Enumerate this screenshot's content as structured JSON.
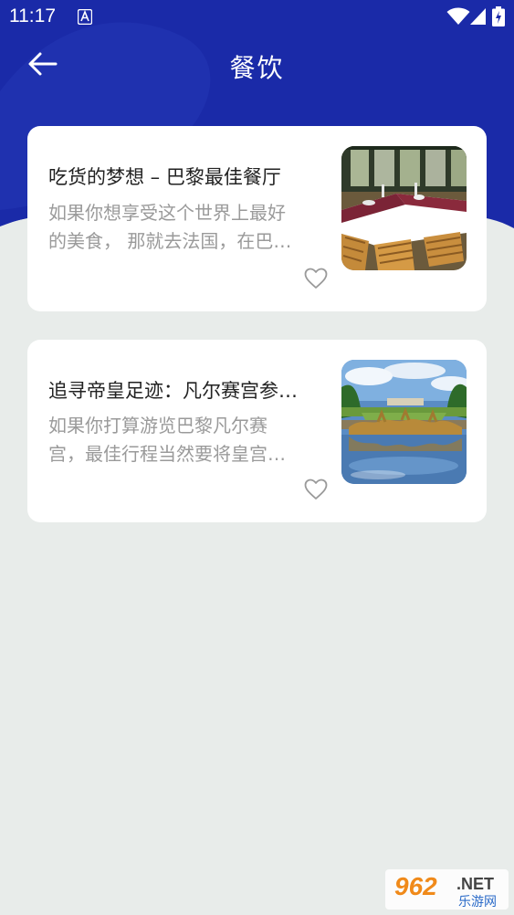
{
  "status_bar": {
    "time": "11:17",
    "icons": [
      "text-a-icon",
      "wifi-icon",
      "signal-icon",
      "battery-icon"
    ]
  },
  "header": {
    "title": "餐饮",
    "back_icon": "arrow-left-icon",
    "background_color": "#1a2aa8"
  },
  "articles": [
    {
      "title": "吃货的梦想 – 巴黎最佳餐厅",
      "desc_line1": "如果你想享受这个世界上最好",
      "desc_line2": "的美食， 那就去法国，在巴…",
      "thumbnail": "restaurant-terrace-image",
      "favorite_icon": "heart-outline-icon"
    },
    {
      "title": "追寻帝皇足迹：凡尔赛宫参…",
      "desc_line1": "如果你打算游览巴黎凡尔赛",
      "desc_line2": "宫，最佳行程当然要将皇宫…",
      "thumbnail": "versailles-fountain-image",
      "favorite_icon": "heart-outline-icon"
    }
  ],
  "watermark": {
    "number": "962",
    "suffix": ".NET",
    "subtitle": "乐游网"
  },
  "colors": {
    "header": "#1a2aa8",
    "background": "#e8ecea",
    "card": "#ffffff",
    "title_text": "#222222",
    "desc_text": "#9a9a9a"
  }
}
